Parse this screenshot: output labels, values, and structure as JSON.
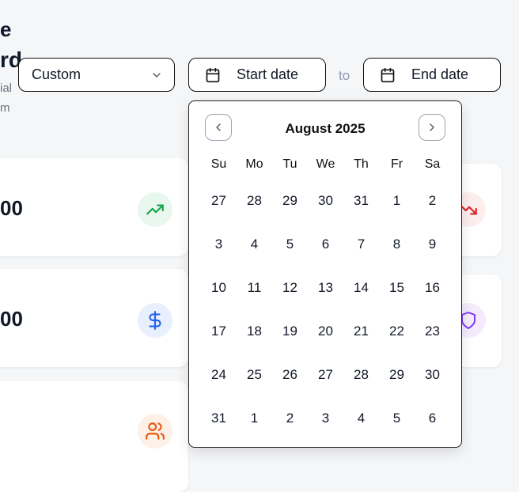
{
  "header": {
    "title_line1": "e",
    "title_line2": "rd",
    "subtitle_line1": "ial",
    "subtitle_line2": "m"
  },
  "filters": {
    "range_select": "Custom",
    "start_label": "Start date",
    "to_label": "to",
    "end_label": "End date"
  },
  "cards": {
    "value1": "00",
    "value2": "00"
  },
  "calendar": {
    "month_label": "August 2025",
    "weekdays": [
      "Su",
      "Mo",
      "Tu",
      "We",
      "Th",
      "Fr",
      "Sa"
    ],
    "weeks": [
      [
        "27",
        "28",
        "29",
        "30",
        "31",
        "1",
        "2"
      ],
      [
        "3",
        "4",
        "5",
        "6",
        "7",
        "8",
        "9"
      ],
      [
        "10",
        "11",
        "12",
        "13",
        "14",
        "15",
        "16"
      ],
      [
        "17",
        "18",
        "19",
        "20",
        "21",
        "22",
        "23"
      ],
      [
        "24",
        "25",
        "26",
        "27",
        "28",
        "29",
        "30"
      ],
      [
        "31",
        "1",
        "2",
        "3",
        "4",
        "5",
        "6"
      ]
    ]
  },
  "icons": {
    "trend_up": "trending-up-icon",
    "dollar": "dollar-icon",
    "users": "users-icon",
    "trend_down": "trending-down-icon",
    "shield": "shield-icon"
  },
  "colors": {
    "green": "#16a34a",
    "blue": "#2563eb",
    "orange": "#ea580c",
    "red": "#dc2626",
    "purple": "#7c3aed"
  }
}
